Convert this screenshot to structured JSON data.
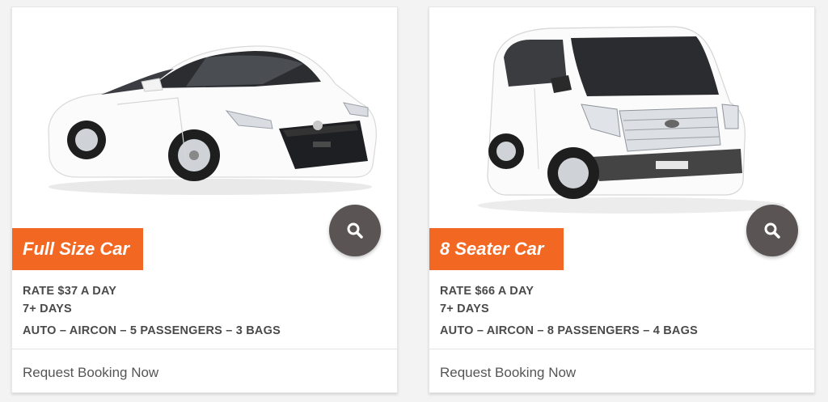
{
  "accent_color": "#f26722",
  "zoom_button_color": "#5a5454",
  "cards": [
    {
      "title": "Full Size Car",
      "rate": "RATE $37 A DAY",
      "days": "7+ DAYS",
      "features": "AUTO – AIRCON – 5 PASSENGERS – 3 BAGS",
      "action": "Request Booking Now",
      "image_alt": "white sedan",
      "icon": "search-icon"
    },
    {
      "title": "8 Seater Car",
      "rate": "RATE $66 A DAY",
      "days": "7+ DAYS",
      "features": "AUTO – AIRCON – 8 PASSENGERS – 4 BAGS",
      "action": "Request Booking Now",
      "image_alt": "white van",
      "icon": "search-icon"
    }
  ]
}
